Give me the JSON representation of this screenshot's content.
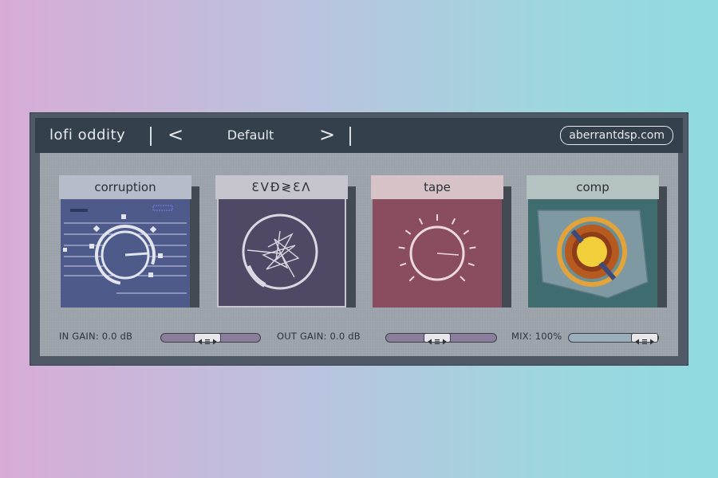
{
  "header": {
    "title": "lofi oddity",
    "prev_symbol": "<",
    "preset": "Default",
    "next_symbol": ">",
    "website": "aberrantdsp.com"
  },
  "modules": [
    {
      "label": "corruption",
      "color": "#4d5a8a",
      "label_bg": "#b7bccb"
    },
    {
      "label": "ƐVƉ≷ƐɅ",
      "color": "#4f4966",
      "label_bg": "#c6c4cc"
    },
    {
      "label": "tape",
      "color": "#8a4c5f",
      "label_bg": "#d7c2c7"
    },
    {
      "label": "comp",
      "color": "#3f6c6f",
      "label_bg": "#b4c2c2"
    }
  ],
  "controls": {
    "in_gain": {
      "label": "IN GAIN:",
      "value": "0.0 dB",
      "position": 0.45
    },
    "out_gain": {
      "label": "OUT GAIN:",
      "value": "0.0 dB",
      "position": 0.45
    },
    "mix": {
      "label": "MIX:",
      "value": "100%",
      "position": 1.0
    }
  },
  "slider_thumb_glyph": "◀≡▶",
  "colors": {
    "header_bg": "#34404c",
    "frame": "#4f5a66",
    "panel": "#9aa1a9",
    "gain_slider": "#8b7d9c",
    "mix_slider": "#9aaebb"
  }
}
